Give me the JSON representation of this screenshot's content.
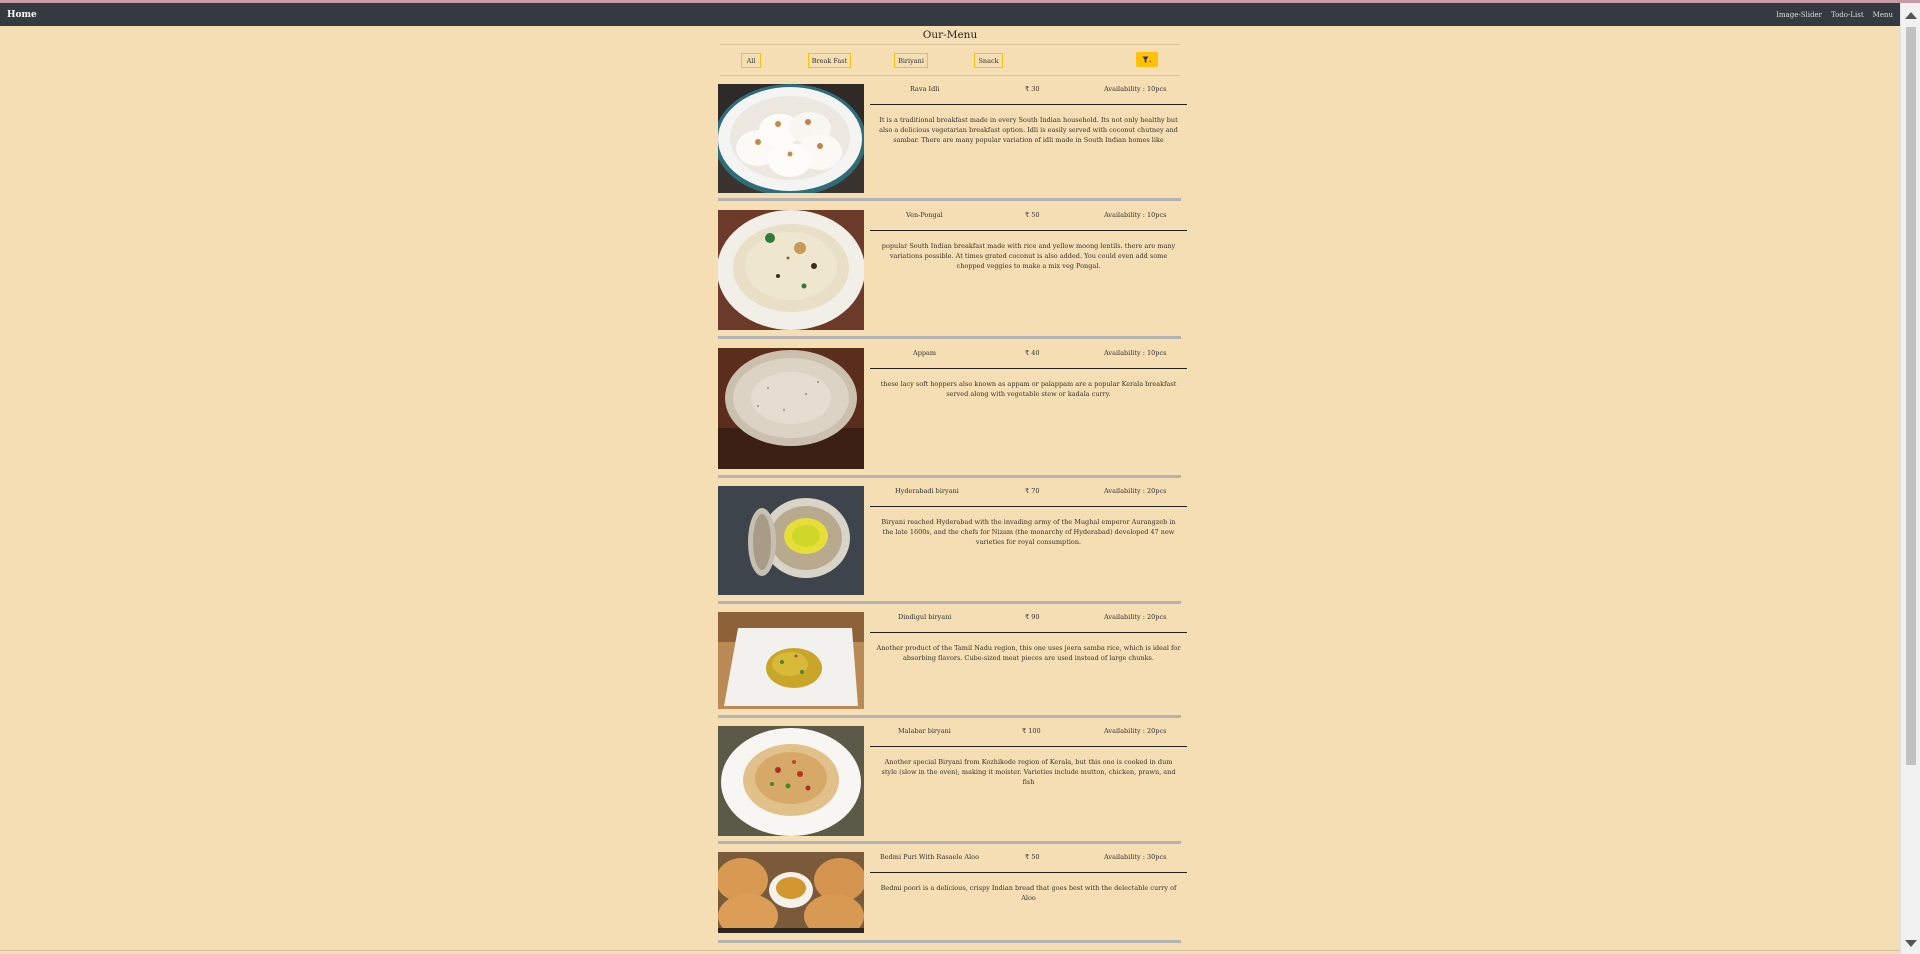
{
  "nav": {
    "brand": "Home",
    "links": [
      "Image-Slider",
      "Todo-List",
      "Menu"
    ]
  },
  "menu": {
    "title": "Our-Menu",
    "filters": [
      "All",
      "Break Fast",
      "Biriyani",
      "Snack"
    ],
    "filter_icon": "filter-icon"
  },
  "items": [
    {
      "name": "Rava Idli",
      "price": "₹ 30",
      "availability": "Availability : 10pcs",
      "description": "It is a traditional breakfast made in every South Indian household. Its not only healthy but also a delicious vegetarian breakfast option. Idli is easily served with coconut chutney and sambar. There are many popular variation of idli made in South Indian homes like"
    },
    {
      "name": "Ven-Pongal",
      "price": "₹ 50",
      "availability": "Availability : 10pcs",
      "description": "popular South Indian breakfast made with rice and yellow moong lentils. there are many variations possible. At times grated coconut is also added. You could even add some chopped veggies to make a mix veg Pongal."
    },
    {
      "name": "Appam",
      "price": "₹ 40",
      "availability": "Availability : 10pcs",
      "description": "these lacy soft hoppers also known as appam or palappam are a popular Kerala breakfast served along with vegetable stew or kadala curry."
    },
    {
      "name": "Hyderabadi biryani",
      "price": "₹ 70",
      "availability": "Availability : 20pcs",
      "description": "Biryani reached Hyderabad with the invading army of the Mughal emperor Aurangzeb in the late 1600s, and the chefs for Nizam (the monarchy of Hyderabad) developed 47 new varieties for royal consumption."
    },
    {
      "name": "Dindigul biryani",
      "price": "₹ 90",
      "availability": "Availability : 20pcs",
      "description": "Another product of the Tamil Nadu region, this one uses jeera samba rice, which is ideal for absorbing flavors. Cube-sized meat pieces are used instead of large chunks."
    },
    {
      "name": "Malabar biryani",
      "price": "₹ 100",
      "availability": "Availability : 20pcs",
      "description": "Another special Biryani from Kozhikode region of Kerala, but this one is cooked in dum style (slow in the oven), making it moister. Varieties include mutton, chicken, prawn, and fish"
    },
    {
      "name": "Bedmi Puri With Rasaele Aloo",
      "price": "₹ 50",
      "availability": "Availability : 30pcs",
      "description": "Bedmi poori is a delicious, crispy Indian bread that goes best with the delectable curry of Aloo"
    }
  ],
  "colors": {
    "background": "#f5deb3",
    "navbar": "#343a40",
    "accent": "#ffc107"
  }
}
